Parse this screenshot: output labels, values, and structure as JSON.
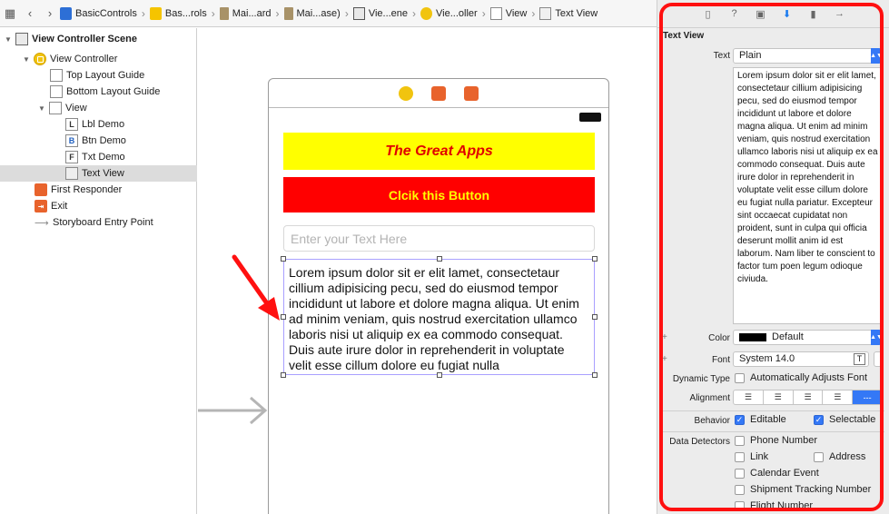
{
  "breadcrumbs": [
    {
      "label": "BasicControls",
      "icon": "project-icon"
    },
    {
      "label": "Bas...rols",
      "icon": "folder-icon"
    },
    {
      "label": "Mai...ard",
      "icon": "storyboard-file-icon"
    },
    {
      "label": "Mai...ase)",
      "icon": "storyboard-file-icon"
    },
    {
      "label": "Vie...ene",
      "icon": "scene-icon"
    },
    {
      "label": "Vie...oller",
      "icon": "view-controller-icon"
    },
    {
      "label": "View",
      "icon": "view-icon"
    },
    {
      "label": "Text View",
      "icon": "text-view-icon"
    }
  ],
  "outline": {
    "scene": "View Controller Scene",
    "view_controller": "View Controller",
    "top_layout_guide": "Top Layout Guide",
    "bottom_layout_guide": "Bottom Layout Guide",
    "view": "View",
    "lbl_demo": "Lbl Demo",
    "btn_demo": "Btn Demo",
    "txt_demo": "Txt Demo",
    "text_view": "Text View",
    "first_responder": "First Responder",
    "exit": "Exit",
    "storyboard_entry_point": "Storyboard Entry Point"
  },
  "outline_icons": {
    "lbl_demo": "L",
    "btn_demo": "B",
    "txt_demo": "F",
    "exit": "⇥"
  },
  "canvas": {
    "label_text": "The Great Apps",
    "button_text": "Clcik this Button",
    "text_field_placeholder": "Enter your Text Here",
    "text_view_text": "Lorem ipsum dolor sit er elit lamet, consectetaur cillium adipisicing pecu, sed do eiusmod tempor incididunt ut labore et dolore magna aliqua. Ut enim ad minim veniam, quis nostrud exercitation ullamco laboris nisi ut aliquip ex ea commodo consequat. Duis aute irure dolor in reprehenderit in voluptate velit esse cillum dolore eu fugiat nulla"
  },
  "inspector": {
    "section_title": "Text View",
    "text_label": "Text",
    "text_type": "Plain",
    "text_content": "Lorem ipsum dolor sit er elit lamet, consectetaur cillium adipisicing pecu, sed do eiusmod tempor incididunt ut labore et dolore magna aliqua. Ut enim ad minim veniam, quis nostrud exercitation ullamco laboris nisi ut aliquip ex ea commodo consequat. Duis aute irure dolor in reprehenderit in voluptate velit esse cillum dolore eu fugiat nulla pariatur. Excepteur sint occaecat cupidatat non proident, sunt in culpa qui officia deserunt mollit anim id est laborum. Nam liber te conscient to factor tum poen legum odioque civiuda.",
    "color_label": "Color",
    "color_value": "Default",
    "font_label": "Font",
    "font_value": "System 14.0",
    "dynamic_type_label": "Dynamic Type",
    "dynamic_type_checkbox": "Automatically Adjusts Font",
    "alignment_label": "Alignment",
    "behavior_label": "Behavior",
    "editable": "Editable",
    "selectable": "Selectable",
    "data_detectors_label": "Data Detectors",
    "detectors": [
      "Phone Number",
      "Link",
      "Address",
      "Calendar Event",
      "Shipment Tracking Number",
      "Flight Number"
    ],
    "plus": "+"
  },
  "colors": {
    "label_bg": "#ffff00",
    "label_fg": "#e00000",
    "button_bg": "#ff0000",
    "button_fg": "#ffff00",
    "accent": "#3478f6",
    "highlight": "#ff1010"
  }
}
